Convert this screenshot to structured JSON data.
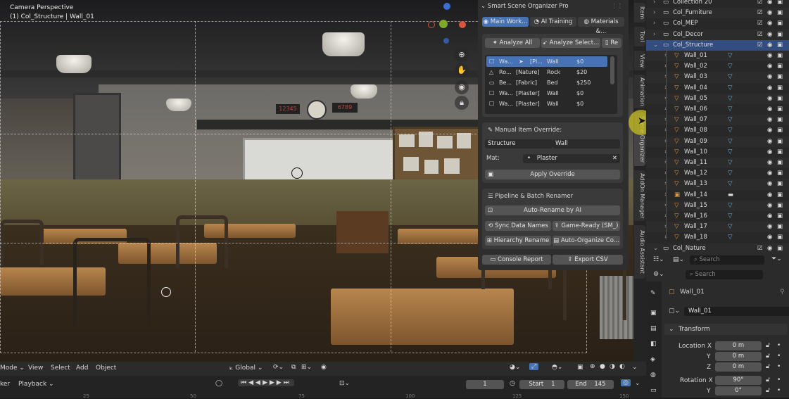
{
  "viewport": {
    "title_line1": "Camera Perspective",
    "title_line2": "(1) Col_Structure | Wall_01",
    "board_digits_left": "12345",
    "board_digits_right": "6789"
  },
  "viewport_header": {
    "mode_label": "Mode",
    "menus": [
      "View",
      "Select",
      "Add",
      "Object"
    ],
    "transform_orientation": "Global"
  },
  "timeline": {
    "left_label": "ker",
    "playback_label": "Playback",
    "current_frame": "1",
    "start_label": "Start",
    "start_value": "1",
    "end_label": "End",
    "end_value": "145",
    "ruler_ticks": [
      "25",
      "50",
      "75",
      "100",
      "125",
      "150"
    ]
  },
  "n_panel_tabs": [
    "Item",
    "Tool",
    "View",
    "Animation",
    "Scene Organizer",
    "AddOn Manager",
    "Audio Assistant"
  ],
  "addon": {
    "title": "Smart Scene Organizer Pro",
    "tabs": [
      "Main Work...",
      "AI Training",
      "Materials &..."
    ],
    "analyze_all": "Analyze All",
    "analyze_selected": "Analyze Select...",
    "re_label": "Re",
    "list_rows": [
      {
        "name": "Wa...",
        "mat": "[Pl...",
        "type": "Wall",
        "price": "$0",
        "selected": true
      },
      {
        "name": "Ro...",
        "mat": "[Nature]",
        "type": "Rock",
        "price": "$20",
        "selected": false
      },
      {
        "name": "Be...",
        "mat": "[Fabric]",
        "type": "Bed",
        "price": "$250",
        "selected": false
      },
      {
        "name": "Wa...",
        "mat": "[Plaster]",
        "type": "Wall",
        "price": "$0",
        "selected": false
      },
      {
        "name": "Wa...",
        "mat": "[Plaster]",
        "type": "Wall",
        "price": "$0",
        "selected": false
      }
    ],
    "manual_override_title": "Manual Item Override:",
    "override_category": "Structure",
    "override_type": "Wall",
    "mat_label": "Mat:",
    "mat_value": "Plaster",
    "apply_override": "Apply Override",
    "pipeline_title": "Pipeline & Batch Renamer",
    "auto_rename": "Auto-Rename by AI",
    "sync_data_names": "Sync Data Names",
    "game_ready": "Game-Ready (SM_)",
    "hierarchy_rename": "Hierarchy Rename",
    "auto_organize": "Auto-Organize Co...",
    "console_report": "Console Report",
    "export_csv": "Export CSV"
  },
  "outliner": {
    "rows": [
      {
        "label": "Collection 20",
        "kind": "collection",
        "indent": 1,
        "expanded": false
      },
      {
        "label": "Col_Furniture",
        "kind": "collection",
        "indent": 1,
        "expanded": false
      },
      {
        "label": "Col_MEP",
        "kind": "collection",
        "indent": 1,
        "expanded": false
      },
      {
        "label": "Col_Decor",
        "kind": "collection",
        "indent": 1,
        "expanded": false
      },
      {
        "label": "Col_Structure",
        "kind": "collection",
        "indent": 1,
        "expanded": true,
        "active": true
      },
      {
        "label": "Wall_01",
        "kind": "mesh",
        "indent": 2
      },
      {
        "label": "Wall_02",
        "kind": "mesh",
        "indent": 2
      },
      {
        "label": "Wall_03",
        "kind": "mesh",
        "indent": 2
      },
      {
        "label": "Wall_04",
        "kind": "mesh",
        "indent": 2
      },
      {
        "label": "Wall_05",
        "kind": "mesh",
        "indent": 2
      },
      {
        "label": "Wall_06",
        "kind": "mesh",
        "indent": 2
      },
      {
        "label": "Wall_07",
        "kind": "mesh",
        "indent": 2
      },
      {
        "label": "Wall_08",
        "kind": "mesh",
        "indent": 2
      },
      {
        "label": "Wall_09",
        "kind": "mesh",
        "indent": 2
      },
      {
        "label": "Wall_10",
        "kind": "mesh",
        "indent": 2
      },
      {
        "label": "Wall_11",
        "kind": "mesh",
        "indent": 2
      },
      {
        "label": "Wall_12",
        "kind": "mesh",
        "indent": 2
      },
      {
        "label": "Wall_13",
        "kind": "mesh",
        "indent": 2
      },
      {
        "label": "Wall_14",
        "kind": "mesh-alt",
        "indent": 2
      },
      {
        "label": "Wall_15",
        "kind": "mesh",
        "indent": 2
      },
      {
        "label": "Wall_16",
        "kind": "mesh",
        "indent": 2
      },
      {
        "label": "Wall_17",
        "kind": "mesh",
        "indent": 2
      },
      {
        "label": "Wall_18",
        "kind": "mesh",
        "indent": 2
      },
      {
        "label": "Col_Nature",
        "kind": "collection",
        "indent": 1,
        "expanded": true
      }
    ],
    "search_placeholder": "Search"
  },
  "properties": {
    "search_placeholder": "Search",
    "object_name": "Wall_01",
    "data_name": "Wall_01",
    "transform_title": "Transform",
    "location_x_label": "Location X",
    "y_label": "Y",
    "z_label": "Z",
    "location_x": "0 m",
    "location_y": "0 m",
    "location_z": "0 m",
    "rotation_x_label": "Rotation X",
    "rotation_x": "90°",
    "rotation_y": "0°"
  },
  "colors": {
    "accent_blue": "#4772b3",
    "object_orange": "#e09a3a",
    "mesh_cyan": "#5fb8d8",
    "cursor_yellow": "#c8c022"
  }
}
